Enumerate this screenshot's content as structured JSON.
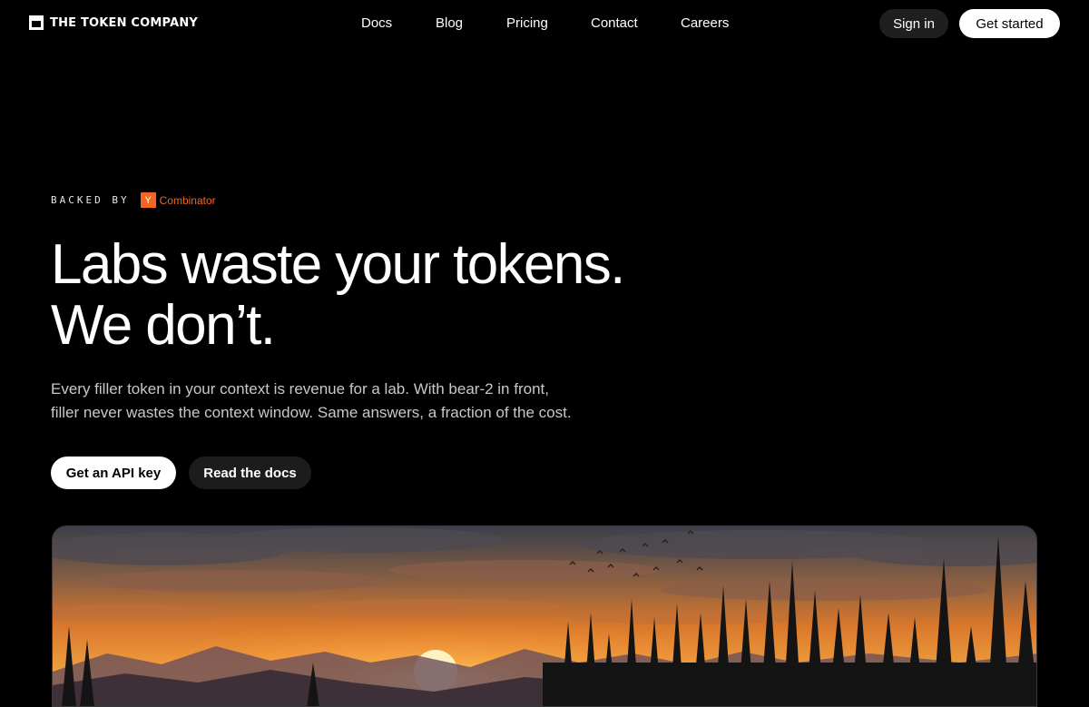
{
  "brand": {
    "name": "THE TOKEN COMPANY",
    "icon": "logo-square-icon"
  },
  "nav": {
    "links": [
      "Docs",
      "Blog",
      "Pricing",
      "Contact",
      "Careers"
    ],
    "sign_in": "Sign in",
    "get_started": "Get started"
  },
  "hero": {
    "backed_by": "BACKED BY",
    "backer_badge": "Y",
    "backer_name": "Combinator",
    "headline": [
      "Labs waste your tokens.",
      "We don’t."
    ],
    "subtext": [
      "Every filler token in your context is revenue for a lab. With bear-2 in front,",
      "filler never wastes the context window. Same answers, a fraction of the cost."
    ],
    "cta_primary": "Get an API key",
    "cta_secondary": "Read the docs"
  },
  "colors": {
    "background": "#000000",
    "yc_orange": "#f26522",
    "button_dark": "#1f1f1f",
    "button_light": "#ffffff"
  }
}
